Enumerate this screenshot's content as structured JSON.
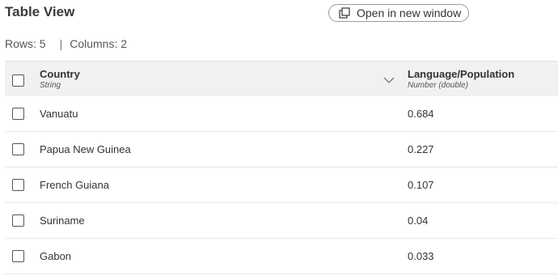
{
  "header": {
    "title": "Table View",
    "open_button_label": "Open in new window",
    "open_icon": "open-external-window-icon"
  },
  "meta": {
    "rows_text": "Rows: 5",
    "separator": "|",
    "columns_text": "Columns: 2"
  },
  "table": {
    "columns": [
      {
        "name": "Country",
        "type": "String"
      },
      {
        "name": "Language/Population",
        "type": "Number (double)"
      }
    ],
    "rows": [
      {
        "country": "Vanuatu",
        "value": "0.684"
      },
      {
        "country": "Papua New Guinea",
        "value": "0.227"
      },
      {
        "country": "French Guiana",
        "value": "0.107"
      },
      {
        "country": "Suriname",
        "value": "0.04"
      },
      {
        "country": "Gabon",
        "value": "0.033"
      }
    ]
  },
  "colors": {
    "header_bg": "#f1f1f1",
    "text": "#333333",
    "border": "#e8e8e8"
  }
}
